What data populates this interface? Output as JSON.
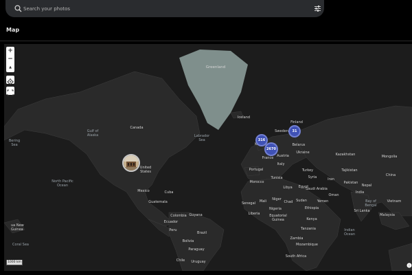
{
  "search": {
    "placeholder": "Search your photos"
  },
  "header": {
    "title": "Map"
  },
  "map": {
    "zoom_in": "+",
    "zoom_out": "−",
    "compass": "▲",
    "scale": "1000 km",
    "clusters": [
      {
        "count": "316"
      },
      {
        "count": "31"
      },
      {
        "count": "2670"
      }
    ],
    "labels": {
      "greenland": "Greenland",
      "iceland": "Iceland",
      "canada": "Canada",
      "gulf_alaska": "Gulf of\nAlaska",
      "bering": "Bering\nSea",
      "labrador": "Labrador\nSea",
      "united_states": "United\nStates",
      "north_pacific": "North Pacific\nOcean",
      "mexico": "Mexico",
      "cuba": "Cuba",
      "guatemala": "Guatemala",
      "colombia": "Colombia",
      "guyana": "Guyana",
      "ecuador": "Ecuador",
      "peru": "Peru",
      "brazil": "Brazil",
      "bolivia": "Bolivia",
      "paraguay": "Paraguay",
      "chile": "Chile",
      "uruguay": "Uruguay",
      "finland": "Finland",
      "sweden": "Sweden",
      "kingdom": "Kin",
      "belarus": "Belarus",
      "ukraine": "Ukraine",
      "france": "France",
      "austria": "Austria",
      "italy": "Italy",
      "portugal": "Portugal",
      "turkey": "Turkey",
      "syria": "Syria",
      "iran": "Iran",
      "tunisia": "Tunisia",
      "morocco": "Morocco",
      "libya": "Libya",
      "egypt": "Egypt",
      "saudi": "Saudi Arabia",
      "oman": "Oman",
      "yemen": "Yemen",
      "senegal": "Senegal",
      "mali": "Mali",
      "niger": "Niger",
      "chad": "Chad",
      "sudan": "Sudan",
      "ethiopia": "Ethiopia",
      "nigeria": "Nigeria",
      "liberia": "Liberia",
      "eq_guinea": "Equatorial\nGuinea",
      "kenya": "Kenya",
      "tanzania": "Tanzania",
      "zambia": "Zambia",
      "mozambique": "Mozambique",
      "south_africa": "South Africa",
      "kazakhstan": "Kazakhstan",
      "tajikistan": "Tajikistan",
      "pakistan": "Pakistan",
      "nepal": "Nepal",
      "india": "India",
      "bay_bengal": "Bay of\nBengal",
      "sri_lanka": "Sri Lanka",
      "indian_ocean": "Indian\nOcean",
      "mongolia": "Mongolia",
      "china": "China",
      "vietnam": "Vietnam",
      "malaysia": "Malaysia",
      "png": "ua New\nGuinea",
      "coral": "Coral Sea"
    }
  }
}
